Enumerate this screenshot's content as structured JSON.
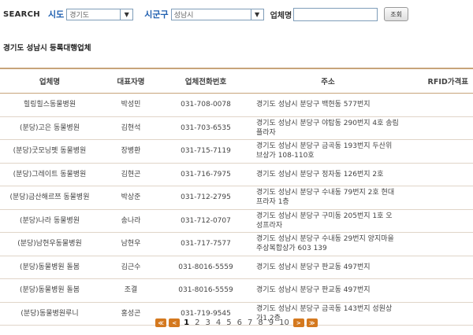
{
  "search": {
    "label": "SEARCH",
    "sido_label": "시도",
    "sido_value": "경기도",
    "sigungu_label": "시군구",
    "sigungu_value": "성남시",
    "name_label": "업체명",
    "name_value": "",
    "button_label": "조회"
  },
  "page_title": "경기도 성남시 등록대행업체",
  "table": {
    "headers": [
      "업체명",
      "대표자명",
      "업체전화번호",
      "주소",
      "RFID가격표"
    ],
    "rows": [
      {
        "name": "힐링힐스동물병원",
        "rep": "박성민",
        "phone": "031-708-0078",
        "address": "경기도 성남시 분당구 백현동   577번지",
        "rfid": ""
      },
      {
        "name": "(분당)고은 동물병원",
        "rep": "김현석",
        "phone": "031-703-6535",
        "address": "경기도 성남시 분당구 야탑동   290번지 4호 송림\n플라자",
        "rfid": ""
      },
      {
        "name": "(분당)굿모닝펫 동물병원",
        "rep": "장병환",
        "phone": "031-715-7119",
        "address": "경기도 성남시 분당구 금곡동   193번지 두산위\n브상가 108-110호",
        "rfid": ""
      },
      {
        "name": "(분당)그레이트 동물병원",
        "rep": "김현곤",
        "phone": "031-716-7975",
        "address": "경기도 성남시 분당구 정자동   126번지 2호",
        "rfid": ""
      },
      {
        "name": "(분당)금산해르쯔 동물병원",
        "rep": "박상준",
        "phone": "031-712-2795",
        "address": "경기도 성남시 분당구 수내동   79번지 2호 현대\n프라자 1층",
        "rfid": ""
      },
      {
        "name": "(분당)나라 동물병원",
        "rep": "송나라",
        "phone": "031-712-0707",
        "address": "경기도 성남시 분당구 구미동   205번지 1호 오\n성프라자",
        "rfid": ""
      },
      {
        "name": "(분당)남현우동물병원",
        "rep": "남현우",
        "phone": "031-717-7577",
        "address": "경기도 성남시 분당구 수내동   29번지 양지마을\n주상복합상가 603 139",
        "rfid": ""
      },
      {
        "name": "(분당)동물병원 돌봄",
        "rep": "김근수",
        "phone": "031-8016-5559",
        "address": "경기도 성남시 분당구 판교동   497번지",
        "rfid": ""
      },
      {
        "name": "(분당)동물병원 돌봄",
        "rep": "조결",
        "phone": "031-8016-5559",
        "address": "경기도 성남시 분당구 판교동   497번지",
        "rfid": ""
      },
      {
        "name": "(분당)동물병원루니",
        "rep": "홍성곤",
        "phone": "031-719-9545",
        "address": "경기도 성남시 분당구 금곡동   143번지 성원상\n가1,2층",
        "rfid": ""
      }
    ]
  },
  "pagination": {
    "first": "≪",
    "prev": "<",
    "pages": [
      "1",
      "2",
      "3",
      "4",
      "5",
      "6",
      "7",
      "8",
      "9",
      "10"
    ],
    "current": "1",
    "next": ">",
    "last": "≫"
  },
  "colors": {
    "accent_blue": "#1f5fb0",
    "table_border": "#c7a47a",
    "pager_button": "#d4791f"
  }
}
